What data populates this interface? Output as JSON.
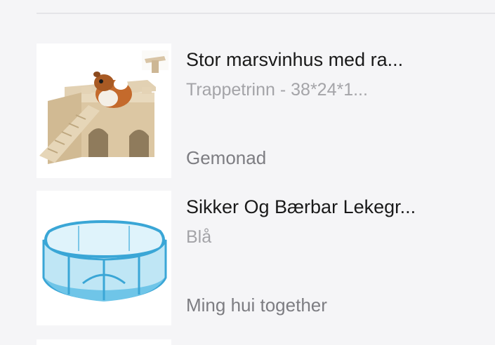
{
  "items": [
    {
      "title": "Stor marsvinhus med ra...",
      "variant": "Trappetrinn - 38*24*1...",
      "seller": "Gemonad",
      "image_icon": "guinea-pig-house-image"
    },
    {
      "title": "Sikker Og Bærbar Lekegr...",
      "variant": "Blå",
      "seller": "Ming hui together",
      "image_icon": "pet-playpen-image"
    }
  ]
}
